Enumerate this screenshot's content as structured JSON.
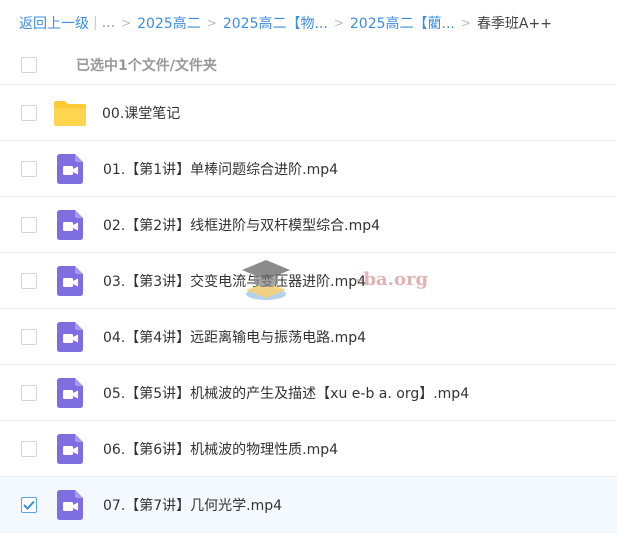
{
  "breadcrumb": {
    "back": "返回上一级",
    "ellipsis": "...",
    "items": [
      "2025高二",
      "2025高二【物...",
      "2025高二【藺..."
    ],
    "current": "春季班A++"
  },
  "selection": {
    "text": "已选中1个文件/文件夹"
  },
  "files": [
    {
      "name": "00.课堂笔记",
      "type": "folder",
      "checked": false
    },
    {
      "name": "01.【第1讲】单棒问题综合进阶.mp4",
      "type": "video",
      "checked": false
    },
    {
      "name": "02.【第2讲】线框进阶与双杆模型综合.mp4",
      "type": "video",
      "checked": false
    },
    {
      "name": "03.【第3讲】交变电流与变压器进阶.mp4",
      "type": "video",
      "checked": false
    },
    {
      "name": "04.【第4讲】远距离输电与振荡电路.mp4",
      "type": "video",
      "checked": false
    },
    {
      "name": "05.【第5讲】机械波的产生及描述【xu e-b a. org】.mp4",
      "type": "video",
      "checked": false
    },
    {
      "name": "06.【第6讲】机械波的物理性质.mp4",
      "type": "video",
      "checked": false
    },
    {
      "name": "07.【第7讲】几何光学.mp4",
      "type": "video",
      "checked": true
    }
  ],
  "watermark": {
    "text": "-ba.org"
  },
  "colors": {
    "accent": "#3b8ee0",
    "video_icon": "#7e6ee0",
    "folder": "#ffcc33",
    "selected_row": "#f3f9ff"
  },
  "icons": {
    "folder": "folder-icon",
    "video": "video-file-icon",
    "check": "check-icon"
  }
}
